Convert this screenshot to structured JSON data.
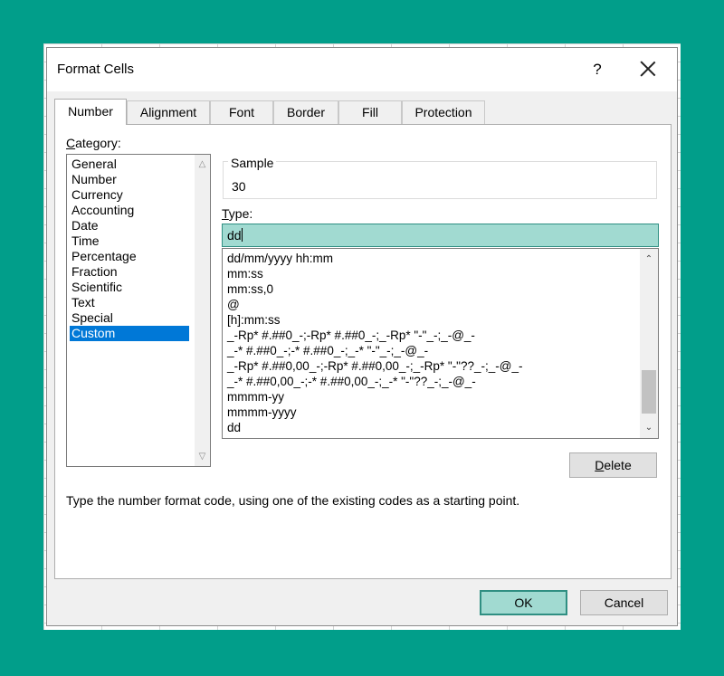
{
  "dialog": {
    "title": "Format Cells",
    "help": "?",
    "close": "close"
  },
  "tabs": [
    {
      "label": "Number",
      "active": true
    },
    {
      "label": "Alignment",
      "active": false
    },
    {
      "label": "Font",
      "active": false
    },
    {
      "label": "Border",
      "active": false
    },
    {
      "label": "Fill",
      "active": false
    },
    {
      "label": "Protection",
      "active": false
    }
  ],
  "category": {
    "label_first": "C",
    "label_rest": "ategory:",
    "items": [
      "General",
      "Number",
      "Currency",
      "Accounting",
      "Date",
      "Time",
      "Percentage",
      "Fraction",
      "Scientific",
      "Text",
      "Special",
      "Custom"
    ],
    "selected": "Custom"
  },
  "sample": {
    "label": "Sample",
    "value": "30"
  },
  "type": {
    "label_first": "T",
    "label_rest": "ype:",
    "value": "dd",
    "items": [
      "dd/mm/yyyy hh:mm",
      "mm:ss",
      "mm:ss,0",
      "@",
      "[h]:mm:ss",
      "_-Rp* #.##0_-;-Rp* #.##0_-;_-Rp* \"-\"_-;_-@_-",
      "_-* #.##0_-;-* #.##0_-;_-* \"-\"_-;_-@_-",
      "_-Rp* #.##0,00_-;-Rp* #.##0,00_-;_-Rp* \"-\"??_-;_-@_-",
      "_-* #.##0,00_-;-* #.##0,00_-;_-* \"-\"??_-;_-@_-",
      "mmmm-yy",
      "mmmm-yyyy",
      "dd"
    ]
  },
  "buttons": {
    "delete_first": "D",
    "delete_rest": "elete",
    "ok": "OK",
    "cancel": "Cancel"
  },
  "description": "Type the number format code, using one of the existing codes as a starting point.",
  "colors": {
    "accent": "#a1dad1",
    "selection": "#0078d7",
    "background": "#019e8a"
  }
}
